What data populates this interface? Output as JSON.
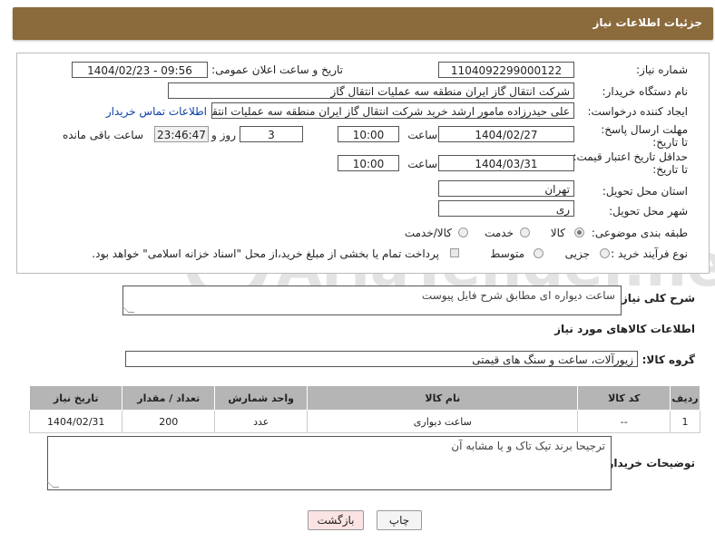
{
  "header": {
    "title": "جزئیات اطلاعات نیاز"
  },
  "fields": {
    "need_number_label": "شماره نیاز:",
    "need_number": "1104092299000122",
    "announce_label": "تاریخ و ساعت اعلان عمومی:",
    "announce_value": "1404/02/23 - 09:56",
    "buyer_label": "نام دستگاه خریدار:",
    "buyer_value": "شرکت انتقال گاز ایران منطقه سه عملیات انتقال گاز",
    "creator_label": "ایجاد کننده درخواست:",
    "creator_value": "علی حیدرزاده مامور ارشد خرید شرکت انتقال گاز ایران منطقه سه عملیات انتقال گاز",
    "contact_link": "اطلاعات تماس خریدار",
    "deadline_label": "مهلت ارسال پاسخ: تا تاریخ:",
    "deadline_date": "1404/02/27",
    "time_label": "ساعت",
    "deadline_time": "10:00",
    "days_value": "3",
    "days_label": "روز و",
    "remaining_value": "23:46:47",
    "remaining_label": "ساعت باقی مانده",
    "validity_label": "حداقل تاریخ اعتبار قیمت: تا تاریخ:",
    "validity_date": "1404/03/31",
    "validity_time": "10:00",
    "province_label": "استان محل تحویل:",
    "province_value": "تهران",
    "city_label": "شهر محل تحویل:",
    "city_value": "ری",
    "category_label": "طبقه بندی موضوعی:",
    "category_options": [
      "کالا",
      "خدمت",
      "کالا/خدمت"
    ],
    "process_label": "نوع فرآیند خرید :",
    "process_options": [
      "جزیی",
      "متوسط"
    ],
    "payment_note": "پرداخت تمام یا بخشی از مبلغ خرید،از محل \"اسناد خزانه اسلامی\" خواهد بود."
  },
  "description": {
    "label": "شرح کلی نیاز:",
    "value": "ساعت دیواره ای مطابق شرح فایل پیوست"
  },
  "goods": {
    "section_title": "اطلاعات کالاهای مورد نیاز",
    "group_label": "گروه کالا:",
    "group_value": "زیورآلات، ساعت و سنگ های قیمتی",
    "columns": [
      "ردیف",
      "کد کالا",
      "نام کالا",
      "واحد شمارش",
      "تعداد / مقدار",
      "تاریخ نیاز"
    ],
    "rows": [
      [
        "1",
        "--",
        "ساعت دیواری",
        "عدد",
        "200",
        "1404/02/31"
      ]
    ]
  },
  "buyer_notes": {
    "label": "توضیحات خریدار:",
    "value": "ترجیحا برند تیک تاک و یا مشابه آن"
  },
  "buttons": {
    "print": "چاپ",
    "back": "بازگشت"
  },
  "watermark": "AriaTender.neT"
}
